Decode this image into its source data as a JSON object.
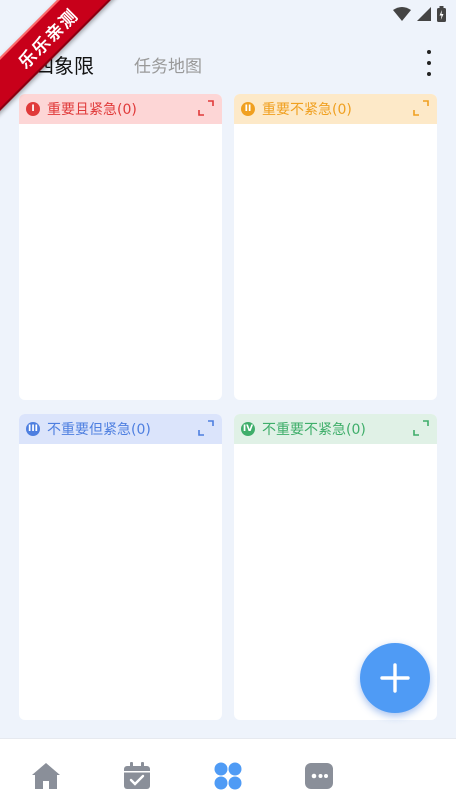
{
  "ribbon": {
    "text": "乐乐亲测"
  },
  "header": {
    "title": "四象限",
    "tab_map": "任务地图"
  },
  "quadrants": [
    {
      "badge": "I",
      "label": "重要且紧急(0)",
      "color": "#e03a3a",
      "bg": "#fdd6d6"
    },
    {
      "badge": "II",
      "label": "重要不紧急(0)",
      "color": "#f0a020",
      "bg": "#fde9c8"
    },
    {
      "badge": "III",
      "label": "不重要但紧急(0)",
      "color": "#4e7fe0",
      "bg": "#dbe4fb"
    },
    {
      "badge": "IV",
      "label": "不重要不紧急(0)",
      "color": "#3fae6a",
      "bg": "#e0f1e6"
    }
  ],
  "bottom_nav": {
    "items": [
      {
        "icon": "home-icon",
        "active": false
      },
      {
        "icon": "calendar-check-icon",
        "active": false
      },
      {
        "icon": "quadrant-grid-icon",
        "active": true
      },
      {
        "icon": "game-controller-icon",
        "active": false
      }
    ],
    "active_color": "#4f9bf5",
    "inactive_color": "#8a8f99"
  }
}
